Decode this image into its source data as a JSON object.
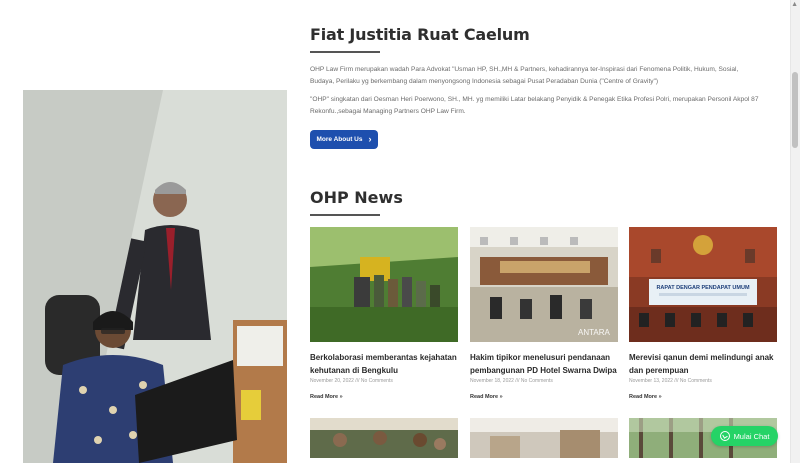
{
  "about": {
    "title": "Fiat Justitia Ruat Caelum",
    "paragraph1": "OHP Law Firm merupakan wadah Para Advokat \"Usman HP, SH.,MH & Partners, kehadirannya  ter-Inspirasi dari Fenomena Politik, Hukum, Sosial, Budaya, Perilaku  yg berkembang dalam  menyongsong Indonesia sebagai Pusat Peradaban Dunia (\"Centre of Gravity\")",
    "paragraph2": "\"OHP\" singkatan dari Oesman Heri Poerwono, SH., MH. yg memiliki Latar belakang Penyidik & Penegak Etika Profesi Polri, merupakan Personil Akpol 87 Rekonfu.,sebagai Managing Partners OHP Law Firm.",
    "button_label": "More About Us",
    "button_icon": "chevron-right-icon"
  },
  "news": {
    "title": "OHP News",
    "items": [
      {
        "headline": "Berkolaborasi memberantas kejahatan kehutanan di Bengkulu",
        "meta": "November 20, 2022 /// No Comments",
        "read_more": "Read More »"
      },
      {
        "headline": "Hakim tipikor menelusuri pendanaan pembangunan PD Hotel Swarna Dwipa",
        "meta": "November 18, 2022 /// No Comments",
        "read_more": "Read More »",
        "image_watermark": "ANTARA"
      },
      {
        "headline": "Merevisi qanun demi melindungi anak dan perempuan",
        "meta": "November 13, 2022 /// No Comments",
        "read_more": "Read More »",
        "image_banner": "RAPAT DENGAR PENDAPAT UMUM"
      }
    ]
  },
  "chat": {
    "label": "Mulai Chat",
    "icon": "whatsapp-icon"
  },
  "colors": {
    "primary_button": "#1e4fae",
    "chat_button": "#25d366",
    "heading": "#2f2f2f"
  }
}
